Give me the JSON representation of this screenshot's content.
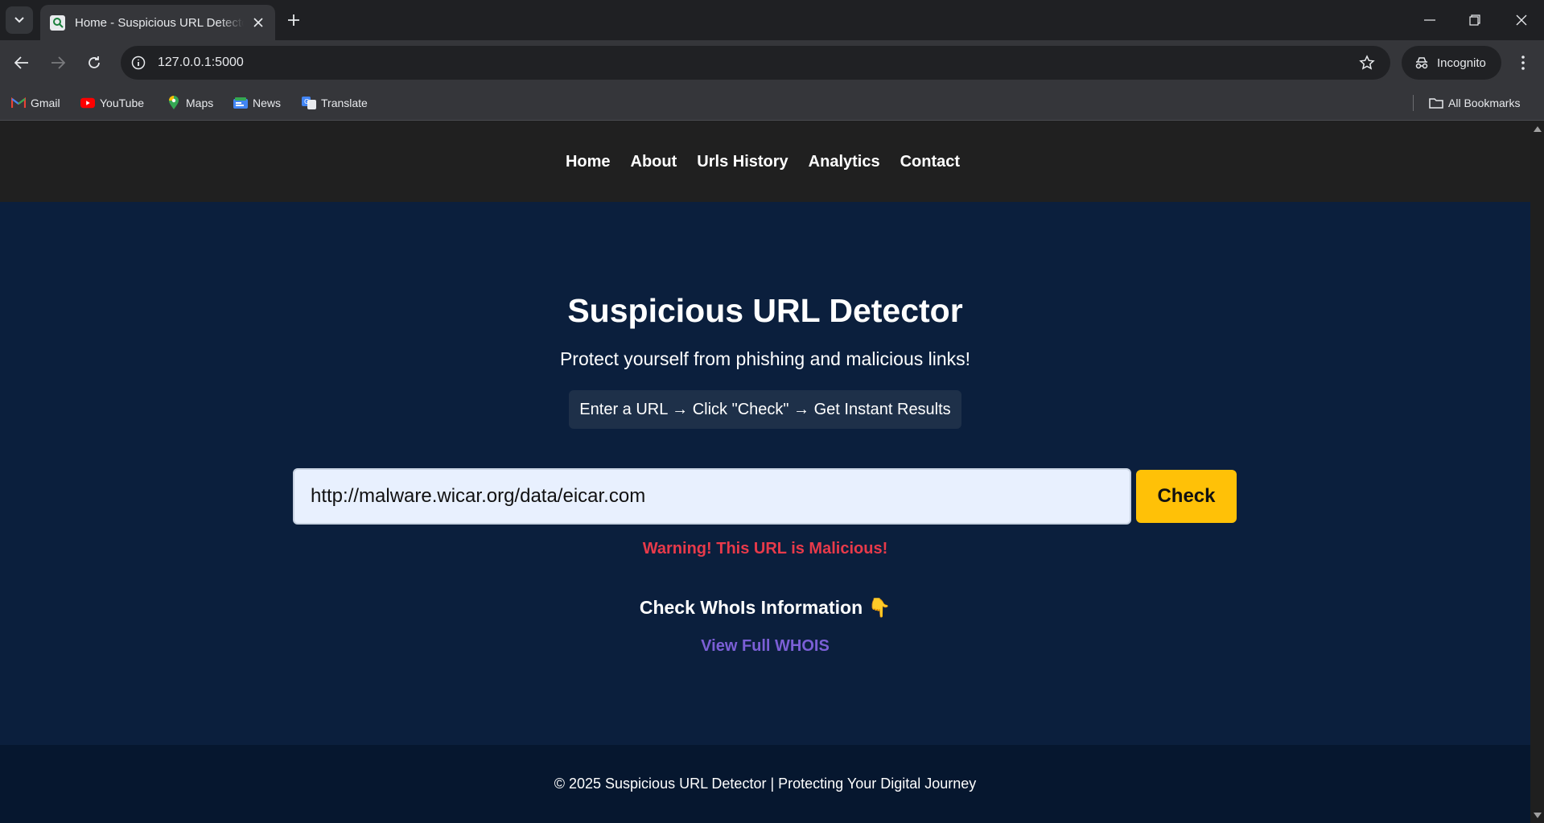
{
  "browser": {
    "tab": {
      "title": "Home - Suspicious URL Detector"
    },
    "address_bar": {
      "url": "127.0.0.1:5000"
    },
    "profile": {
      "label": "Incognito"
    },
    "bookmarks": [
      {
        "label": "Gmail",
        "icon": "gmail-icon"
      },
      {
        "label": "YouTube",
        "icon": "youtube-icon"
      },
      {
        "label": "Maps",
        "icon": "maps-icon"
      },
      {
        "label": "News",
        "icon": "news-icon"
      },
      {
        "label": "Translate",
        "icon": "translate-icon"
      }
    ],
    "all_bookmarks": "All Bookmarks"
  },
  "site": {
    "nav": [
      "Home",
      "About",
      "Urls History",
      "Analytics",
      "Contact"
    ],
    "hero": {
      "title": "Suspicious URL Detector",
      "subtitle": "Protect yourself from phishing and malicious links!",
      "hint": "Enter a URL → Click \"Check\" → Get Instant Results"
    },
    "form": {
      "url_value": "http://malware.wicar.org/data/eicar.com",
      "check_label": "Check"
    },
    "result": {
      "warning": "Warning! This URL is Malicious!"
    },
    "whois": {
      "title": "Check WhoIs Information 👇",
      "link": "View Full WHOIS"
    },
    "footer": "© 2025 Suspicious URL Detector | Protecting Your Digital Journey"
  },
  "colors": {
    "page_bg": "#0b1f3d",
    "nav_bg": "#202020",
    "accent": "#ffc107",
    "warning": "#e83a4a",
    "link": "#7b5fd6"
  }
}
